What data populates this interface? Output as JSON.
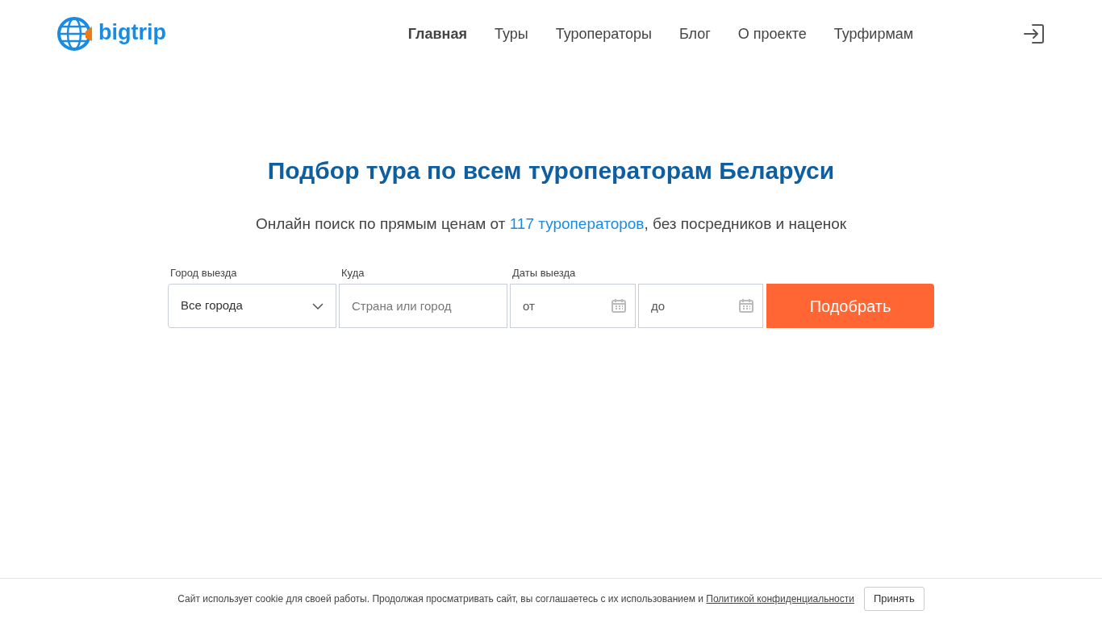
{
  "header": {
    "logo": "bigtrip",
    "nav": [
      {
        "label": "Главная",
        "selected": true
      },
      {
        "label": "Туры",
        "selected": false
      },
      {
        "label": "Туроператоры",
        "selected": false
      },
      {
        "label": "Блог",
        "selected": false
      },
      {
        "label": "О проекте",
        "selected": false
      },
      {
        "label": "Турфирмам",
        "selected": false
      }
    ]
  },
  "hero": {
    "title": "Подбор тура по всем туроператорам Беларуси",
    "subtitle": {
      "before": "Онлайн поиск по прямым ценам от ",
      "link": "117 туроператоров",
      "after": ", без посредников и наценок"
    }
  },
  "search": {
    "city": {
      "label": "Город выезда",
      "value": "Все города"
    },
    "destination": {
      "label": "Куда",
      "placeholder": "Страна или город"
    },
    "dates": {
      "label": "Даты выезда",
      "from_placeholder": "от",
      "to_placeholder": "до"
    },
    "button": "Подобрать"
  },
  "cookie_bar": {
    "text": "Сайт использует cookie для своей работы. Продолжая просматривать сайт, вы соглашаетесь с их использованием и ",
    "link": "Политикой конфиденциальности",
    "button": "Принять"
  }
}
